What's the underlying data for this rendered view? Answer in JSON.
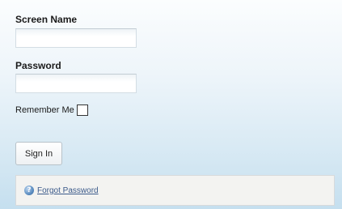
{
  "form": {
    "screen_name_label": "Screen Name",
    "screen_name_value": "",
    "password_label": "Password",
    "password_value": "",
    "remember_label": "Remember Me",
    "remember_checked": false,
    "signin_label": "Sign In",
    "forgot_label": "Forgot Password"
  },
  "icons": {
    "help": "help-icon"
  },
  "colors": {
    "link": "#3b5a8a",
    "background_bottom": "#c5dfef"
  }
}
